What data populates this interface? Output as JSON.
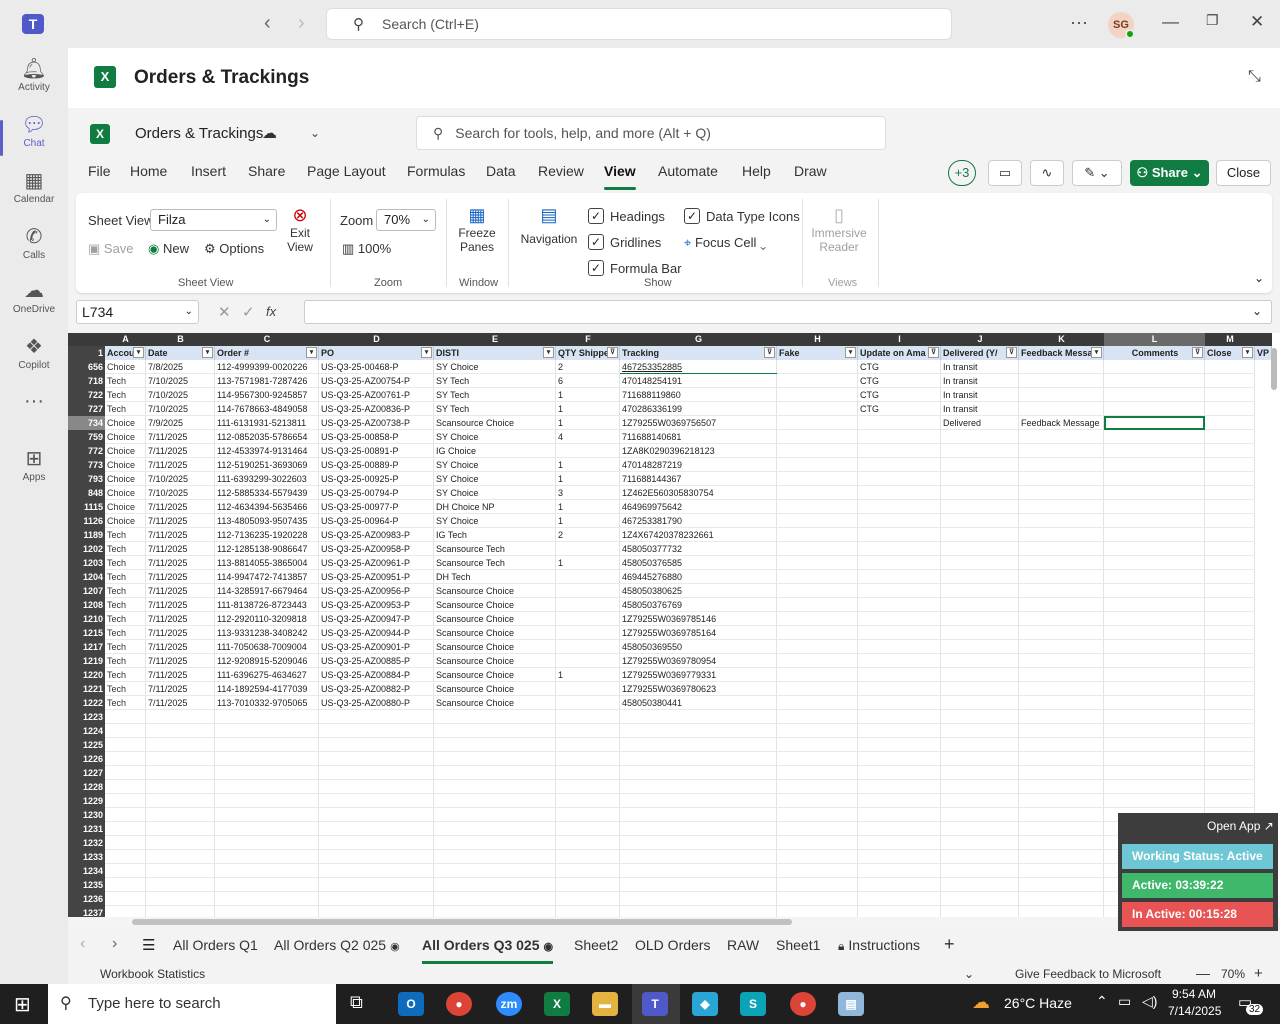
{
  "titlebar": {
    "search_placeholder": "Search (Ctrl+E)",
    "avatar_initials": "SG"
  },
  "rail": [
    {
      "label": "Activity",
      "icon": "bell-icon"
    },
    {
      "label": "Chat",
      "icon": "chat-icon",
      "active": true
    },
    {
      "label": "Calendar",
      "icon": "calendar-icon"
    },
    {
      "label": "Calls",
      "icon": "phone-icon"
    },
    {
      "label": "OneDrive",
      "icon": "cloud-icon"
    },
    {
      "label": "Copilot",
      "icon": "copilot-icon"
    },
    {
      "label": "",
      "icon": "more-icon"
    },
    {
      "label": "Apps",
      "icon": "apps-icon"
    }
  ],
  "app": {
    "title": "Orders & Trackings"
  },
  "excel": {
    "doc_name": "Orders & Trackings",
    "tool_search": "Search for tools, help, and more (Alt + Q)",
    "menu": [
      "File",
      "Home",
      "Insert",
      "Share",
      "Page Layout",
      "Formulas",
      "Data",
      "Review",
      "View",
      "Automate",
      "Help",
      "Draw"
    ],
    "active_menu": "View",
    "collaborators": "+3",
    "share_label": "Share",
    "close_label": "Close"
  },
  "ribbon": {
    "sheet_view_label": "Sheet View",
    "sheet_view_value": "Filza",
    "save": "Save",
    "new": "New",
    "options": "Options",
    "exit_view": [
      "Exit",
      "View"
    ],
    "group_sheet_view": "Sheet View",
    "zoom_label": "Zoom",
    "zoom_value": "70%",
    "zoom_100": "100%",
    "group_zoom": "Zoom",
    "freeze": [
      "Freeze",
      "Panes"
    ],
    "group_window": "Window",
    "navigation": "Navigation",
    "headings": "Headings",
    "gridlines": "Gridlines",
    "formula_bar": "Formula Bar",
    "data_type_icons": "Data Type Icons",
    "focus_cell": "Focus Cell",
    "group_show": "Show",
    "immersive": [
      "Immersive",
      "Reader"
    ],
    "group_views": "Views"
  },
  "formula": {
    "namebox": "L734",
    "fx": "fx",
    "value": ""
  },
  "grid": {
    "columns": [
      "A",
      "B",
      "C",
      "D",
      "E",
      "F",
      "G",
      "H",
      "I",
      "J",
      "K",
      "L",
      "M"
    ],
    "headers": [
      "Accou",
      "Date",
      "Order #",
      "PO",
      "DISTI",
      "QTY Shippe",
      "Tracking",
      "Fake",
      "Update on Ama",
      "Delivered (Y/",
      "Feedback Messa",
      "Comments",
      "Close",
      "VP"
    ],
    "rows": [
      [
        "656",
        "Choice",
        "7/8/2025",
        "112-4999399-0020226",
        "US-Q3-25-00468-P",
        "SY Choice",
        "2",
        "467253352885",
        "",
        "CTG",
        "In transit",
        "",
        ""
      ],
      [
        "718",
        "Tech",
        "7/10/2025",
        "113-7571981-7287426",
        "US-Q3-25-AZ00754-P",
        "SY Tech",
        "6",
        "470148254191",
        "",
        "CTG",
        "In transit",
        "",
        ""
      ],
      [
        "722",
        "Tech",
        "7/10/2025",
        "114-9567300-9245857",
        "US-Q3-25-AZ00761-P",
        "SY Tech",
        "1",
        "711688119860",
        "",
        "CTG",
        "In transit",
        "",
        ""
      ],
      [
        "727",
        "Tech",
        "7/10/2025",
        "114-7678663-4849058",
        "US-Q3-25-AZ00836-P",
        "SY Tech",
        "1",
        "470286336199",
        "",
        "CTG",
        "In transit",
        "",
        ""
      ],
      [
        "734",
        "Choice",
        "7/9/2025",
        "111-6131931-5213811",
        "US-Q3-25-AZ00738-P",
        "Scansource Choice",
        "1",
        "1Z79255W0369756507",
        "",
        "",
        "Delivered",
        "Feedback Message",
        ""
      ],
      [
        "759",
        "Choice",
        "7/11/2025",
        "112-0852035-5786654",
        "US-Q3-25-00858-P",
        "SY Choice",
        "4",
        "711688140681",
        "",
        "",
        "",
        "",
        ""
      ],
      [
        "772",
        "Choice",
        "7/11/2025",
        "112-4533974-9131464",
        "US-Q3-25-00891-P",
        "IG Choice",
        "",
        "1ZA8K0290396218123",
        "",
        "",
        "",
        "",
        ""
      ],
      [
        "773",
        "Choice",
        "7/11/2025",
        "112-5190251-3693069",
        "US-Q3-25-00889-P",
        "SY Choice",
        "1",
        "470148287219",
        "",
        "",
        "",
        "",
        ""
      ],
      [
        "793",
        "Choice",
        "7/10/2025",
        "111-6393299-3022603",
        "US-Q3-25-00925-P",
        "SY Choice",
        "1",
        "711688144367",
        "",
        "",
        "",
        "",
        ""
      ],
      [
        "848",
        "Choice",
        "7/10/2025",
        "112-5885334-5579439",
        "US-Q3-25-00794-P",
        "SY Choice",
        "3",
        "1Z462E560305830754",
        "",
        "",
        "",
        "",
        ""
      ],
      [
        "1115",
        "Choice",
        "7/11/2025",
        "112-4634394-5635466",
        "US-Q3-25-00977-P",
        "DH Choice NP",
        "1",
        "464969975642",
        "",
        "",
        "",
        "",
        ""
      ],
      [
        "1126",
        "Choice",
        "7/11/2025",
        "113-4805093-9507435",
        "US-Q3-25-00964-P",
        "SY Choice",
        "1",
        "467253381790",
        "",
        "",
        "",
        "",
        ""
      ],
      [
        "1189",
        "Tech",
        "7/11/2025",
        "112-7136235-1920228",
        "US-Q3-25-AZ00983-P",
        "IG Tech",
        "2",
        "1Z4X67420378232661",
        "",
        "",
        "",
        "",
        ""
      ],
      [
        "1202",
        "Tech",
        "7/11/2025",
        "112-1285138-9086647",
        "US-Q3-25-AZ00958-P",
        "Scansource Tech",
        "",
        "458050377732",
        "",
        "",
        "",
        "",
        ""
      ],
      [
        "1203",
        "Tech",
        "7/11/2025",
        "113-8814055-3865004",
        "US-Q3-25-AZ00961-P",
        "Scansource Tech",
        "1",
        "458050376585",
        "",
        "",
        "",
        "",
        ""
      ],
      [
        "1204",
        "Tech",
        "7/11/2025",
        "114-9947472-7413857",
        "US-Q3-25-AZ00951-P",
        "DH Tech",
        "",
        "469445276880",
        "",
        "",
        "",
        "",
        ""
      ],
      [
        "1207",
        "Tech",
        "7/11/2025",
        "114-3285917-6679464",
        "US-Q3-25-AZ00956-P",
        "Scansource Choice",
        "",
        "458050380625",
        "",
        "",
        "",
        "",
        ""
      ],
      [
        "1208",
        "Tech",
        "7/11/2025",
        "111-8138726-8723443",
        "US-Q3-25-AZ00953-P",
        "Scansource Choice",
        "",
        "458050376769",
        "",
        "",
        "",
        "",
        ""
      ],
      [
        "1210",
        "Tech",
        "7/11/2025",
        "112-2920110-3209818",
        "US-Q3-25-AZ00947-P",
        "Scansource Choice",
        "",
        "1Z79255W0369785146",
        "",
        "",
        "",
        "",
        ""
      ],
      [
        "1215",
        "Tech",
        "7/11/2025",
        "113-9331238-3408242",
        "US-Q3-25-AZ00944-P",
        "Scansource Choice",
        "",
        "1Z79255W0369785164",
        "",
        "",
        "",
        "",
        ""
      ],
      [
        "1217",
        "Tech",
        "7/11/2025",
        "111-7050638-7009004",
        "US-Q3-25-AZ00901-P",
        "Scansource Choice",
        "",
        "458050369550",
        "",
        "",
        "",
        "",
        ""
      ],
      [
        "1219",
        "Tech",
        "7/11/2025",
        "112-9208915-5209046",
        "US-Q3-25-AZ00885-P",
        "Scansource Choice",
        "",
        "1Z79255W0369780954",
        "",
        "",
        "",
        "",
        ""
      ],
      [
        "1220",
        "Tech",
        "7/11/2025",
        "111-6396275-4634627",
        "US-Q3-25-AZ00884-P",
        "Scansource Choice",
        "1",
        "1Z79255W0369779331",
        "",
        "",
        "",
        "",
        ""
      ],
      [
        "1221",
        "Tech",
        "7/11/2025",
        "114-1892594-4177039",
        "US-Q3-25-AZ00882-P",
        "Scansource Choice",
        "",
        "1Z79255W0369780623",
        "",
        "",
        "",
        "",
        ""
      ],
      [
        "1222",
        "Tech",
        "7/11/2025",
        "113-7010332-9705065",
        "US-Q3-25-AZ00880-P",
        "Scansource Choice",
        "",
        "458050380441",
        "",
        "",
        "",
        "",
        ""
      ]
    ],
    "empty_rows": [
      "1223",
      "1224",
      "1225",
      "1226",
      "1227",
      "1228",
      "1229",
      "1230",
      "1231",
      "1232",
      "1233",
      "1234",
      "1235",
      "1236",
      "1237"
    ]
  },
  "sheets": [
    "All Orders Q1",
    "All Orders Q2 025",
    "All Orders Q3 025",
    "Sheet2",
    "OLD Orders",
    "RAW",
    "Sheet1",
    "Instructions"
  ],
  "active_sheet": "All Orders Q3 025",
  "status": {
    "left": "Workbook Statistics",
    "feedback": "Give Feedback to Microsoft",
    "zoom": "70%"
  },
  "widget": {
    "open_app": "Open App",
    "working": "Working Status: Active",
    "active": "Active: 03:39:22",
    "inactive": "In Active: 00:15:28"
  },
  "taskbar": {
    "search": "Type here to search",
    "weather": "26°C  Haze",
    "time": "9:54 AM",
    "date": "7/14/2025",
    "notif": "32"
  }
}
